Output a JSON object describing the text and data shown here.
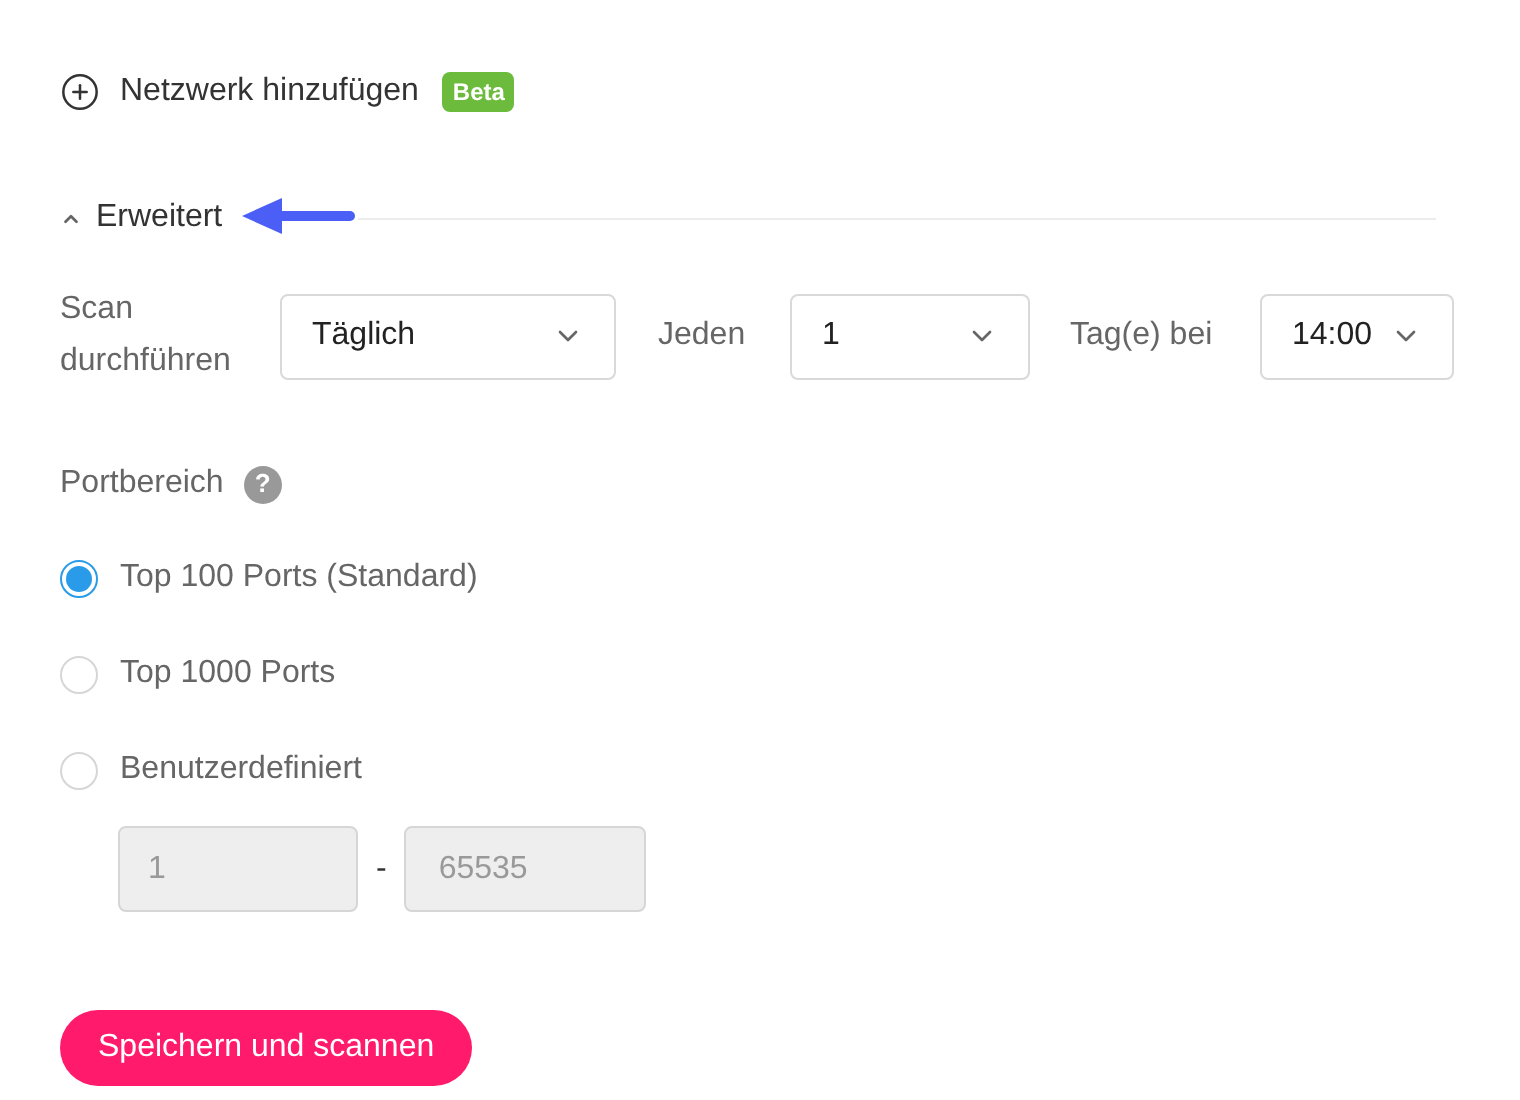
{
  "add_network": {
    "label": "Netzwerk hinzufügen",
    "badge": "Beta"
  },
  "advanced": {
    "label": "Erweitert",
    "expanded": true
  },
  "schedule": {
    "label": "Scan durchführen",
    "frequency": "Täglich",
    "every_label": "Jeden",
    "interval": "1",
    "unit_label": "Tag(e) bei",
    "time": "14:00"
  },
  "port_range": {
    "label": "Portbereich",
    "help": "?",
    "options": [
      {
        "label": "Top 100 Ports (Standard)",
        "selected": true
      },
      {
        "label": "Top 1000 Ports",
        "selected": false
      },
      {
        "label": "Benutzerdefiniert",
        "selected": false
      }
    ],
    "from": "1",
    "separator": "-",
    "to": "65535",
    "disabled": true
  },
  "submit": "Speichern und scannen"
}
